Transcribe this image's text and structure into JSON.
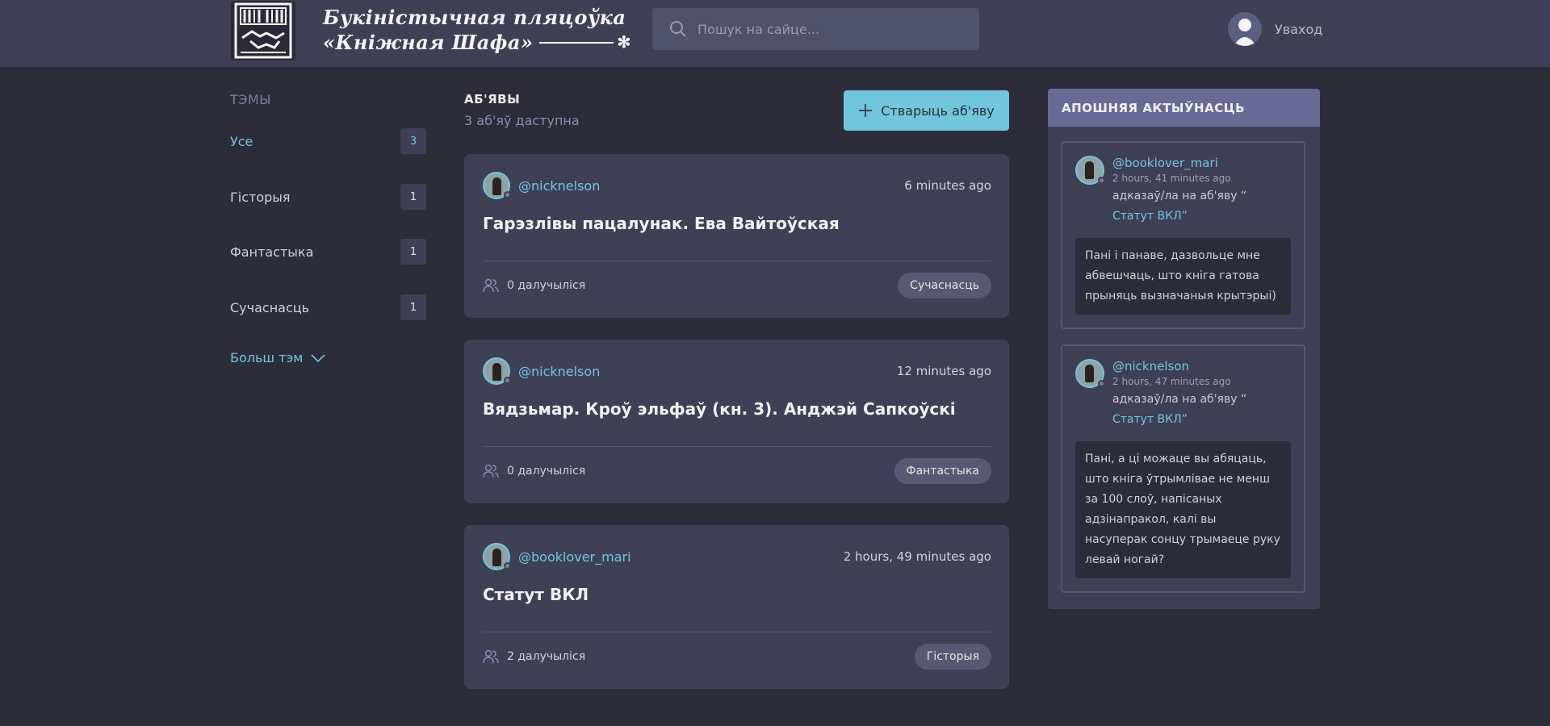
{
  "header": {
    "logo_title_line1": "Букіністычная пляцоўка",
    "logo_title_line2": "«Кніжная Шафа»",
    "search_placeholder": "Пошук на сайце...",
    "login_label": "Уваход"
  },
  "sidebar": {
    "heading": "ТЭМЫ",
    "topics": [
      {
        "label": "Усе",
        "count": "3"
      },
      {
        "label": "Гісторыя",
        "count": "1"
      },
      {
        "label": "Фантастыка",
        "count": "1"
      },
      {
        "label": "Сучаснасць",
        "count": "1"
      }
    ],
    "more_label": "Больш тэм"
  },
  "main": {
    "title": "АБ'ЯВЫ",
    "subtitle": "3 аб'яў даступна",
    "create_label": "Стварыць аб'яву",
    "cards": [
      {
        "author": "@nicknelson",
        "time": "6 minutes ago",
        "title": "Гарэзлівы пацалунак. Ева Вайтоўская",
        "joined": "0 далучыліся",
        "tag": "Сучаснасць"
      },
      {
        "author": "@nicknelson",
        "time": "12 minutes ago",
        "title": "Вядзьмар. Кроў эльфаў (кн. 3). Анджэй Сапкоўскі",
        "joined": "0 далучыліся",
        "tag": "Фантастыка"
      },
      {
        "author": "@booklover_mari",
        "time": "2 hours, 49 minutes ago",
        "title": "Статут ВКЛ",
        "joined": "2 далучыліся",
        "tag": "Гісторыя"
      }
    ]
  },
  "activity": {
    "heading": "АПОШНЯЯ АКТЫЎНАСЦЬ",
    "items": [
      {
        "user": "@booklover_mari",
        "time": "2 hours, 41 minutes ago",
        "action": "адказаў/ла на аб'яву “",
        "link": "Статут ВКЛ”",
        "quote": "Пані і панаве, дазвольце мне абвешчаць, што кніга гатова прыняць вызначаныя крытэрыі)"
      },
      {
        "user": "@nicknelson",
        "time": "2 hours, 47 minutes ago",
        "action": "адказаў/ла на аб'яву “",
        "link": "Статут ВКЛ”",
        "quote": "Пані, а ці можаце вы абяцаць, што кніга ўтрымлівае не менш за 100 слоў, напісаных адзінапракол, калі вы насуперак сонцу трымаеце руку левай ногай?"
      }
    ]
  },
  "colors": {
    "accent": "#71c6dd",
    "background": "#2d2d39",
    "panel": "#3f4056",
    "activity_header": "#696a96"
  }
}
